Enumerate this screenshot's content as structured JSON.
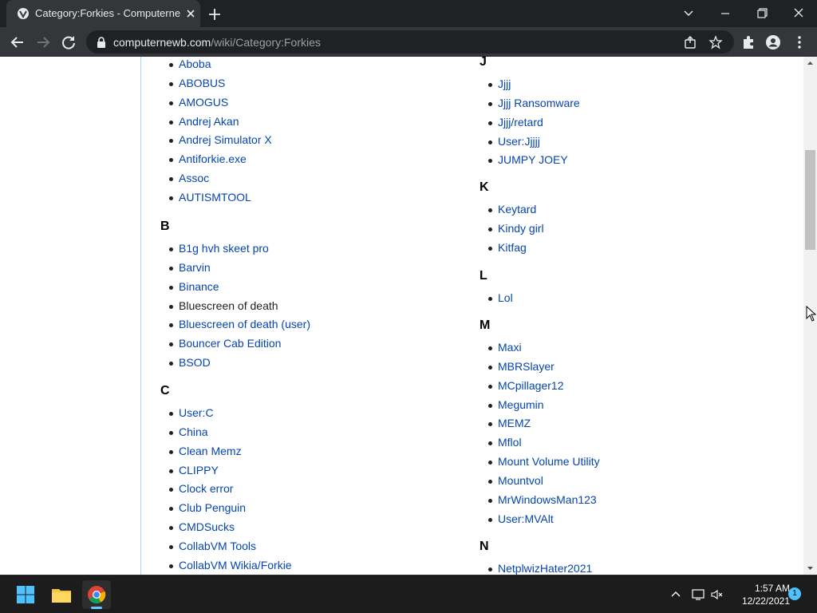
{
  "browser": {
    "tab_title": "Category:Forkies - Computernewb",
    "url_domain": "computernewb.com",
    "url_path": "/wiki/Category:Forkies"
  },
  "colors": {
    "link": "#0645ad",
    "link_visited": "#0b0080",
    "chrome_dark": "#202124",
    "chrome_toolbar": "#35363a",
    "taskbar": "#1c1c1c",
    "accent": "#60cdff"
  },
  "left_column": {
    "sections": [
      {
        "heading": "",
        "items": [
          "Aboba",
          "ABOBUS",
          "AMOGUS",
          "Andrej Akan",
          "Andrej Simulator X",
          "Antiforkie.exe",
          "Assoc",
          "AUTISMTOOL"
        ]
      },
      {
        "heading": "B",
        "items": [
          "B1g hvh skeet pro",
          "Barvin",
          "Binance",
          "Bluescreen of death",
          "Bluescreen of death (user)",
          "Bouncer Cab Edition",
          "BSOD"
        ]
      },
      {
        "heading": "C",
        "items": [
          "User:C",
          "China",
          "Clean Memz",
          "CLIPPY",
          "Clock error",
          "Club Penguin",
          "CMDSucks",
          "CollabVM Tools",
          "CollabVM Wikia/Forkie"
        ]
      }
    ]
  },
  "right_column": {
    "sections": [
      {
        "heading": "J",
        "items": [
          "Jjjj",
          "Jjjj Ransomware",
          "Jjjj/retard",
          "User:Jjjjj",
          "JUMPY JOEY"
        ]
      },
      {
        "heading": "K",
        "items": [
          "Keytard",
          "Kindy girl",
          "Kitfag"
        ]
      },
      {
        "heading": "L",
        "items": [
          "Lol"
        ]
      },
      {
        "heading": "M",
        "items": [
          "Maxi",
          "MBRSlayer",
          "MCpillager12",
          "Megumin",
          "MEMZ",
          "Mflol",
          "Mount Volume Utility",
          "Mountvol",
          "MrWindowsMan123",
          "User:MVAlt"
        ]
      },
      {
        "heading": "N",
        "items": [
          "NetplwizHater2021"
        ]
      }
    ]
  },
  "taskbar": {
    "time": "1:57 AM",
    "date": "12/22/2021",
    "notification_count": "1"
  }
}
